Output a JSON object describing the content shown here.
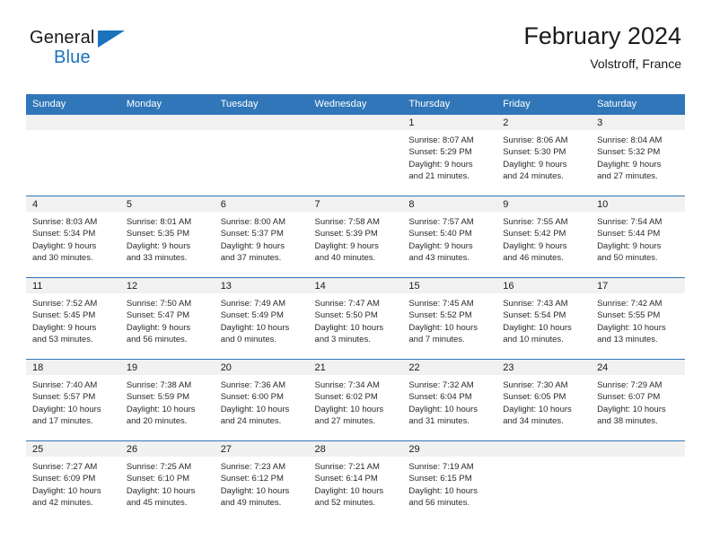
{
  "brand": {
    "name_top": "General",
    "name_bottom": "Blue",
    "accent_color": "#1b72bd"
  },
  "header": {
    "title": "February 2024",
    "location": "Volstroff, France"
  },
  "calendar": {
    "header_background": "#3076b8",
    "daynum_background": "#f1f1f1",
    "weekday_headers": [
      "Sunday",
      "Monday",
      "Tuesday",
      "Wednesday",
      "Thursday",
      "Friday",
      "Saturday"
    ],
    "weeks": [
      [
        {
          "day": "",
          "lines": []
        },
        {
          "day": "",
          "lines": []
        },
        {
          "day": "",
          "lines": []
        },
        {
          "day": "",
          "lines": []
        },
        {
          "day": "1",
          "lines": [
            "Sunrise: 8:07 AM",
            "Sunset: 5:29 PM",
            "Daylight: 9 hours",
            "and 21 minutes."
          ]
        },
        {
          "day": "2",
          "lines": [
            "Sunrise: 8:06 AM",
            "Sunset: 5:30 PM",
            "Daylight: 9 hours",
            "and 24 minutes."
          ]
        },
        {
          "day": "3",
          "lines": [
            "Sunrise: 8:04 AM",
            "Sunset: 5:32 PM",
            "Daylight: 9 hours",
            "and 27 minutes."
          ]
        }
      ],
      [
        {
          "day": "4",
          "lines": [
            "Sunrise: 8:03 AM",
            "Sunset: 5:34 PM",
            "Daylight: 9 hours",
            "and 30 minutes."
          ]
        },
        {
          "day": "5",
          "lines": [
            "Sunrise: 8:01 AM",
            "Sunset: 5:35 PM",
            "Daylight: 9 hours",
            "and 33 minutes."
          ]
        },
        {
          "day": "6",
          "lines": [
            "Sunrise: 8:00 AM",
            "Sunset: 5:37 PM",
            "Daylight: 9 hours",
            "and 37 minutes."
          ]
        },
        {
          "day": "7",
          "lines": [
            "Sunrise: 7:58 AM",
            "Sunset: 5:39 PM",
            "Daylight: 9 hours",
            "and 40 minutes."
          ]
        },
        {
          "day": "8",
          "lines": [
            "Sunrise: 7:57 AM",
            "Sunset: 5:40 PM",
            "Daylight: 9 hours",
            "and 43 minutes."
          ]
        },
        {
          "day": "9",
          "lines": [
            "Sunrise: 7:55 AM",
            "Sunset: 5:42 PM",
            "Daylight: 9 hours",
            "and 46 minutes."
          ]
        },
        {
          "day": "10",
          "lines": [
            "Sunrise: 7:54 AM",
            "Sunset: 5:44 PM",
            "Daylight: 9 hours",
            "and 50 minutes."
          ]
        }
      ],
      [
        {
          "day": "11",
          "lines": [
            "Sunrise: 7:52 AM",
            "Sunset: 5:45 PM",
            "Daylight: 9 hours",
            "and 53 minutes."
          ]
        },
        {
          "day": "12",
          "lines": [
            "Sunrise: 7:50 AM",
            "Sunset: 5:47 PM",
            "Daylight: 9 hours",
            "and 56 minutes."
          ]
        },
        {
          "day": "13",
          "lines": [
            "Sunrise: 7:49 AM",
            "Sunset: 5:49 PM",
            "Daylight: 10 hours",
            "and 0 minutes."
          ]
        },
        {
          "day": "14",
          "lines": [
            "Sunrise: 7:47 AM",
            "Sunset: 5:50 PM",
            "Daylight: 10 hours",
            "and 3 minutes."
          ]
        },
        {
          "day": "15",
          "lines": [
            "Sunrise: 7:45 AM",
            "Sunset: 5:52 PM",
            "Daylight: 10 hours",
            "and 7 minutes."
          ]
        },
        {
          "day": "16",
          "lines": [
            "Sunrise: 7:43 AM",
            "Sunset: 5:54 PM",
            "Daylight: 10 hours",
            "and 10 minutes."
          ]
        },
        {
          "day": "17",
          "lines": [
            "Sunrise: 7:42 AM",
            "Sunset: 5:55 PM",
            "Daylight: 10 hours",
            "and 13 minutes."
          ]
        }
      ],
      [
        {
          "day": "18",
          "lines": [
            "Sunrise: 7:40 AM",
            "Sunset: 5:57 PM",
            "Daylight: 10 hours",
            "and 17 minutes."
          ]
        },
        {
          "day": "19",
          "lines": [
            "Sunrise: 7:38 AM",
            "Sunset: 5:59 PM",
            "Daylight: 10 hours",
            "and 20 minutes."
          ]
        },
        {
          "day": "20",
          "lines": [
            "Sunrise: 7:36 AM",
            "Sunset: 6:00 PM",
            "Daylight: 10 hours",
            "and 24 minutes."
          ]
        },
        {
          "day": "21",
          "lines": [
            "Sunrise: 7:34 AM",
            "Sunset: 6:02 PM",
            "Daylight: 10 hours",
            "and 27 minutes."
          ]
        },
        {
          "day": "22",
          "lines": [
            "Sunrise: 7:32 AM",
            "Sunset: 6:04 PM",
            "Daylight: 10 hours",
            "and 31 minutes."
          ]
        },
        {
          "day": "23",
          "lines": [
            "Sunrise: 7:30 AM",
            "Sunset: 6:05 PM",
            "Daylight: 10 hours",
            "and 34 minutes."
          ]
        },
        {
          "day": "24",
          "lines": [
            "Sunrise: 7:29 AM",
            "Sunset: 6:07 PM",
            "Daylight: 10 hours",
            "and 38 minutes."
          ]
        }
      ],
      [
        {
          "day": "25",
          "lines": [
            "Sunrise: 7:27 AM",
            "Sunset: 6:09 PM",
            "Daylight: 10 hours",
            "and 42 minutes."
          ]
        },
        {
          "day": "26",
          "lines": [
            "Sunrise: 7:25 AM",
            "Sunset: 6:10 PM",
            "Daylight: 10 hours",
            "and 45 minutes."
          ]
        },
        {
          "day": "27",
          "lines": [
            "Sunrise: 7:23 AM",
            "Sunset: 6:12 PM",
            "Daylight: 10 hours",
            "and 49 minutes."
          ]
        },
        {
          "day": "28",
          "lines": [
            "Sunrise: 7:21 AM",
            "Sunset: 6:14 PM",
            "Daylight: 10 hours",
            "and 52 minutes."
          ]
        },
        {
          "day": "29",
          "lines": [
            "Sunrise: 7:19 AM",
            "Sunset: 6:15 PM",
            "Daylight: 10 hours",
            "and 56 minutes."
          ]
        },
        {
          "day": "",
          "lines": []
        },
        {
          "day": "",
          "lines": []
        }
      ]
    ]
  }
}
